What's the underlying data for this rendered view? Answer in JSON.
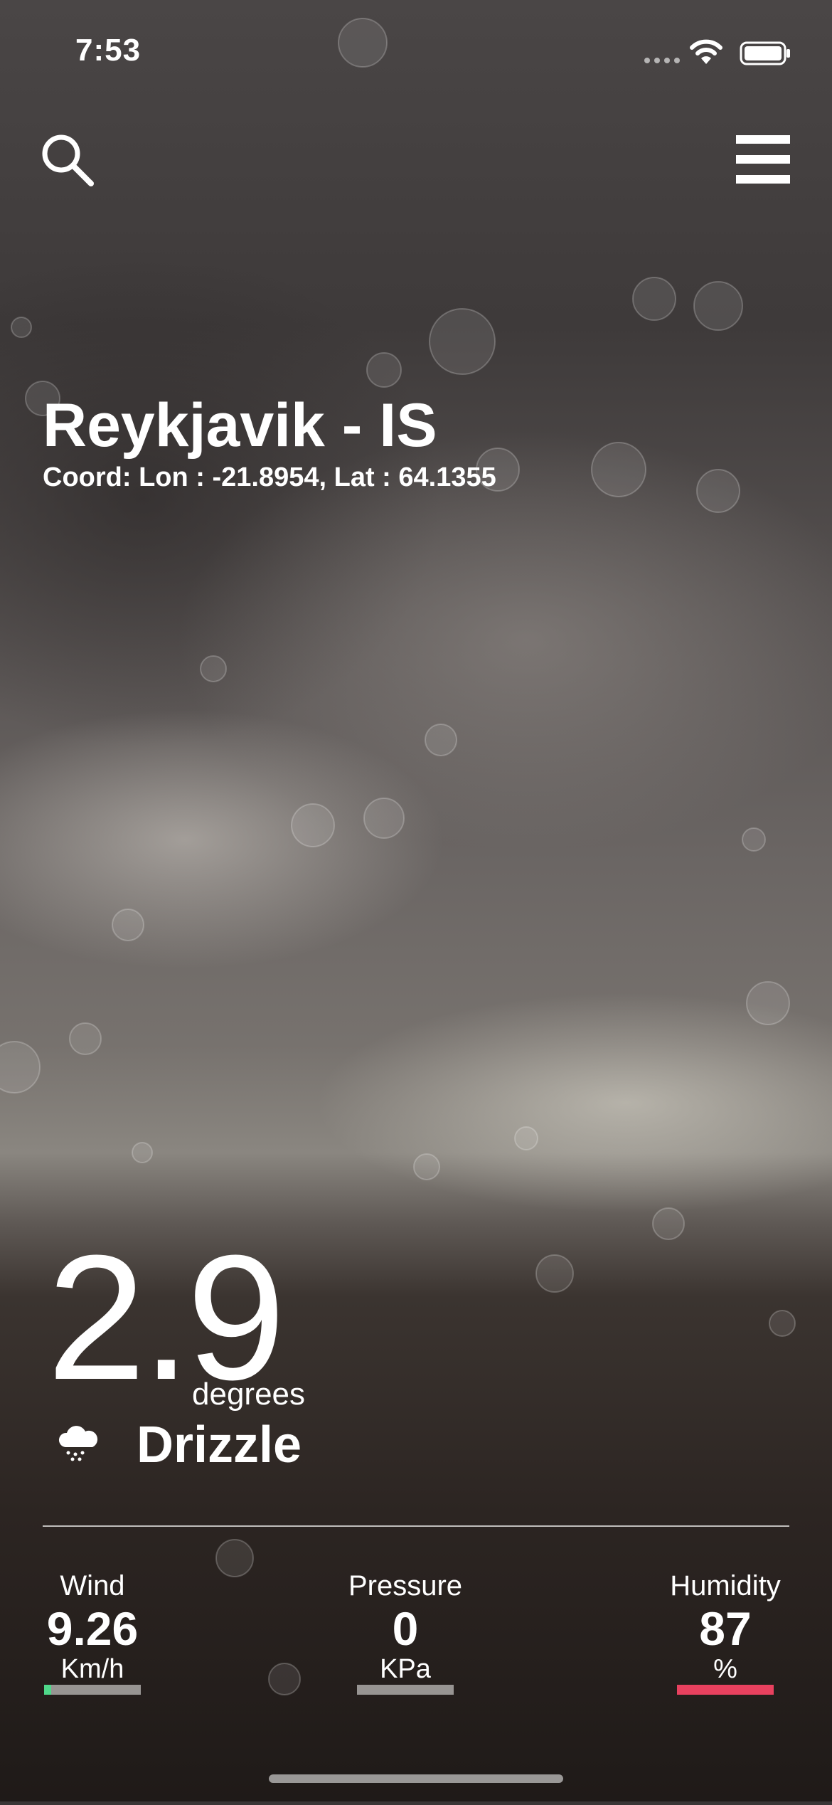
{
  "status_bar": {
    "time": "7:53",
    "icons": [
      "cellular-dots-icon",
      "wifi-icon",
      "battery-icon"
    ]
  },
  "header": {
    "search_icon": "search-icon",
    "menu_icon": "hamburger-menu-icon"
  },
  "location": {
    "city": "Reykjavik - IS",
    "coords": "Coord: Lon : -21.8954, Lat : 64.1355"
  },
  "current": {
    "temperature": "2.9",
    "unit": "degrees",
    "condition": "Drizzle",
    "condition_icon": "cloud-drizzle-icon"
  },
  "stats": [
    {
      "label": "Wind",
      "value": "9.26",
      "unit": "Km/h",
      "level": 0.07,
      "color": "#4fd88a"
    },
    {
      "label": "Pressure",
      "value": "0",
      "unit": "KPa",
      "level": 0,
      "color": "#999999"
    },
    {
      "label": "Humidity",
      "value": "87",
      "unit": "%",
      "level": 1.0,
      "color": "#e8415f"
    }
  ]
}
